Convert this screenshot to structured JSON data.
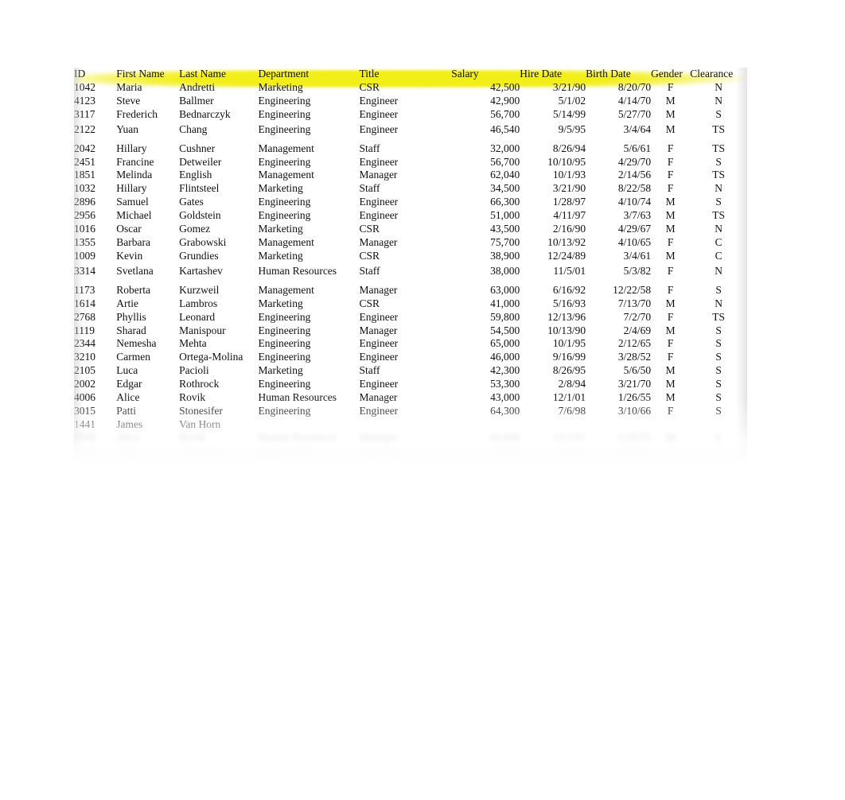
{
  "sheet": {
    "title": "Employee Records",
    "header_highlight_color": "#f2ee18",
    "text_color": "#111111",
    "background_color": "#ffffff"
  },
  "table": {
    "columns": [
      {
        "key": "id",
        "label": "ID",
        "align": "left"
      },
      {
        "key": "first",
        "label": "First Name",
        "align": "left"
      },
      {
        "key": "last",
        "label": "Last Name",
        "align": "left"
      },
      {
        "key": "dept",
        "label": "Department",
        "align": "left"
      },
      {
        "key": "title",
        "label": "Title",
        "align": "left"
      },
      {
        "key": "salary",
        "label": "Salary",
        "align": "right"
      },
      {
        "key": "hire",
        "label": "Hire Date",
        "align": "right"
      },
      {
        "key": "birth",
        "label": "Birth Date",
        "align": "right"
      },
      {
        "key": "gender",
        "label": "Gender",
        "align": "center"
      },
      {
        "key": "clearance",
        "label": "Clearance",
        "align": "center"
      }
    ],
    "rows": [
      {
        "id": "1042",
        "first": "Maria",
        "last": "Andretti",
        "dept": "Marketing",
        "title": "CSR",
        "salary": "42,500",
        "hire": "3/21/90",
        "birth": "8/20/70",
        "gender": "F",
        "clearance": "N"
      },
      {
        "id": "4123",
        "first": "Steve",
        "last": "Ballmer",
        "dept": "Engineering",
        "title": "Engineer",
        "salary": "42,900",
        "hire": "5/1/02",
        "birth": "4/14/70",
        "gender": "M",
        "clearance": "N"
      },
      {
        "id": "3117",
        "first": "Frederich",
        "last": "Bednarczyk",
        "dept": "Engineering",
        "title": "Engineer",
        "salary": "56,700",
        "hire": "5/14/99",
        "birth": "5/27/70",
        "gender": "M",
        "clearance": "S"
      },
      {
        "id": "2122",
        "first": "Yuan",
        "last": "Chang",
        "dept": "Engineering",
        "title": "Engineer",
        "salary": "46,540",
        "hire": "9/5/95",
        "birth": "3/4/64",
        "gender": "M",
        "clearance": "TS"
      },
      {
        "id": "2042",
        "first": "Hillary",
        "last": "Cushner",
        "dept": "Management",
        "title": "Staff",
        "salary": "32,000",
        "hire": "8/26/94",
        "birth": "5/6/61",
        "gender": "F",
        "clearance": "TS"
      },
      {
        "id": "2451",
        "first": "Francine",
        "last": "Detweiler",
        "dept": "Engineering",
        "title": "Engineer",
        "salary": "56,700",
        "hire": "10/10/95",
        "birth": "4/29/70",
        "gender": "F",
        "clearance": "S"
      },
      {
        "id": "1851",
        "first": "Melinda",
        "last": "English",
        "dept": "Management",
        "title": "Manager",
        "salary": "62,040",
        "hire": "10/1/93",
        "birth": "2/14/56",
        "gender": "F",
        "clearance": "TS"
      },
      {
        "id": "1032",
        "first": "Hillary",
        "last": "Flintsteel",
        "dept": "Marketing",
        "title": "Staff",
        "salary": "34,500",
        "hire": "3/21/90",
        "birth": "8/22/58",
        "gender": "F",
        "clearance": "N"
      },
      {
        "id": "2896",
        "first": "Samuel",
        "last": "Gates",
        "dept": "Engineering",
        "title": "Engineer",
        "salary": "66,300",
        "hire": "1/28/97",
        "birth": "4/10/74",
        "gender": "M",
        "clearance": "S"
      },
      {
        "id": "2956",
        "first": "Michael",
        "last": "Goldstein",
        "dept": "Engineering",
        "title": "Engineer",
        "salary": "51,000",
        "hire": "4/11/97",
        "birth": "3/7/63",
        "gender": "M",
        "clearance": "TS"
      },
      {
        "id": "1016",
        "first": "Oscar",
        "last": "Gomez",
        "dept": "Marketing",
        "title": "CSR",
        "salary": "43,500",
        "hire": "2/16/90",
        "birth": "4/29/67",
        "gender": "M",
        "clearance": "N"
      },
      {
        "id": "1355",
        "first": "Barbara",
        "last": "Grabowski",
        "dept": "Management",
        "title": "Manager",
        "salary": "75,700",
        "hire": "10/13/92",
        "birth": "4/10/65",
        "gender": "F",
        "clearance": "C"
      },
      {
        "id": "1009",
        "first": "Kevin",
        "last": "Grundies",
        "dept": "Marketing",
        "title": "CSR",
        "salary": "38,900",
        "hire": "12/24/89",
        "birth": "3/4/61",
        "gender": "M",
        "clearance": "C"
      },
      {
        "id": "3314",
        "first": "Svetlana",
        "last": "Kartashev",
        "dept": "Human Resources",
        "title": "Staff",
        "salary": "38,000",
        "hire": "11/5/01",
        "birth": "5/3/82",
        "gender": "F",
        "clearance": "N"
      },
      {
        "id": "1173",
        "first": "Roberta",
        "last": "Kurzweil",
        "dept": "Management",
        "title": "Manager",
        "salary": "63,000",
        "hire": "6/16/92",
        "birth": "12/22/58",
        "gender": "F",
        "clearance": "S"
      },
      {
        "id": "1614",
        "first": "Artie",
        "last": "Lambros",
        "dept": "Marketing",
        "title": "CSR",
        "salary": "41,000",
        "hire": "5/16/93",
        "birth": "7/13/70",
        "gender": "M",
        "clearance": "N"
      },
      {
        "id": "2768",
        "first": "Phyllis",
        "last": "Leonard",
        "dept": "Engineering",
        "title": "Engineer",
        "salary": "59,800",
        "hire": "12/13/96",
        "birth": "7/2/70",
        "gender": "F",
        "clearance": "TS"
      },
      {
        "id": "1119",
        "first": "Sharad",
        "last": "Manispour",
        "dept": "Engineering",
        "title": "Manager",
        "salary": "54,500",
        "hire": "10/13/90",
        "birth": "2/4/69",
        "gender": "M",
        "clearance": "S"
      },
      {
        "id": "2344",
        "first": "Nemesha",
        "last": "Mehta",
        "dept": "Engineering",
        "title": "Engineer",
        "salary": "65,000",
        "hire": "10/1/95",
        "birth": "2/12/65",
        "gender": "F",
        "clearance": "S"
      },
      {
        "id": "3210",
        "first": "Carmen",
        "last": "Ortega-Molina",
        "dept": "Engineering",
        "title": "Engineer",
        "salary": "46,000",
        "hire": "9/16/99",
        "birth": "3/28/52",
        "gender": "F",
        "clearance": "S"
      },
      {
        "id": "2105",
        "first": "Luca",
        "last": "Pacioli",
        "dept": "Marketing",
        "title": "Staff",
        "salary": "42,300",
        "hire": "8/26/95",
        "birth": "5/6/50",
        "gender": "M",
        "clearance": "S"
      },
      {
        "id": "2002",
        "first": "Edgar",
        "last": "Rothrock",
        "dept": "Engineering",
        "title": "Engineer",
        "salary": "53,300",
        "hire": "2/8/94",
        "birth": "3/21/70",
        "gender": "M",
        "clearance": "S"
      },
      {
        "id": "4006",
        "first": "Alice",
        "last": "Rovik",
        "dept": "Human Resources",
        "title": "Manager",
        "salary": "43,000",
        "hire": "12/1/01",
        "birth": "1/26/55",
        "gender": "M",
        "clearance": "S"
      },
      {
        "id": "3015",
        "first": "Patti",
        "last": "Stonesifer",
        "dept": "Engineering",
        "title": "Engineer",
        "salary": "64,300",
        "hire": "7/6/98",
        "birth": "3/10/66",
        "gender": "F",
        "clearance": "S"
      },
      {
        "id": "1441",
        "first": "James",
        "last": "Van Horn",
        "dept": "",
        "title": "",
        "salary": "",
        "hire": "",
        "birth": "",
        "gender": "",
        "clearance": ""
      }
    ]
  }
}
